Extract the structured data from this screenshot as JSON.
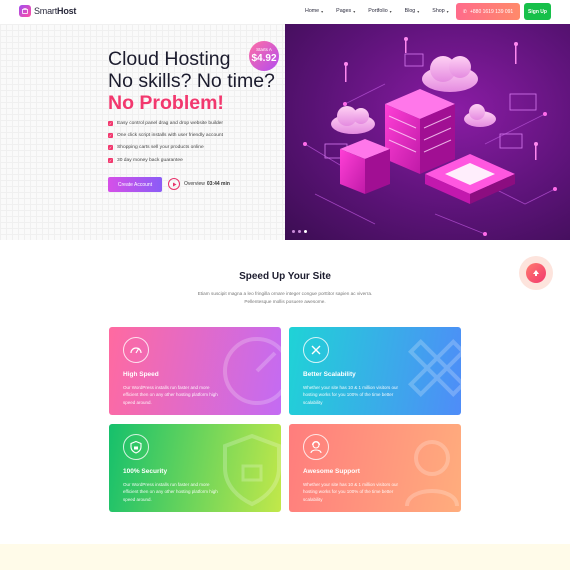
{
  "nav": {
    "brand_light": "Smart",
    "brand_bold": "Host",
    "menu": [
      {
        "label": "Home"
      },
      {
        "label": "Pages"
      },
      {
        "label": "Portfolio"
      },
      {
        "label": "Blog"
      },
      {
        "label": "Shop"
      }
    ],
    "phone": "+880 1619 139 091",
    "signup": "Sign Up"
  },
  "hero": {
    "title_line1": "Cloud Hosting",
    "title_line2": "No skills? No time?",
    "title_line3": "No Problem!",
    "badge_top": "Starts A",
    "badge_price": "$4.92",
    "features": [
      "Easy control panel drag and drop website builder",
      "One click script installs with user friendly account",
      "Shopping carts sell your products online",
      "30 day money back guarantee"
    ],
    "cta": "Create Account",
    "overview_label": "Overview",
    "overview_time": "03:44 min",
    "colors": {
      "accent": "#f2386e",
      "purple": "#8a1ca4"
    }
  },
  "section": {
    "title": "Speed Up Your Site",
    "desc": "Etiam suscipit magna a leo fringilla ornare integer congue porttitor sapien ac viverra. Pellentesque mollis posuere awesome."
  },
  "cards": [
    {
      "title": "High Speed",
      "text": "Our WordPress installs run faster and more efficient then on any other hosting platform high speed around.",
      "icon": "speedometer-icon"
    },
    {
      "title": "Better Scalability",
      "text": "Whether your site has 10 & 1 million visitors our hosting works for you 100% of the time better scalability",
      "icon": "pencil-ruler-icon"
    },
    {
      "title": "100% Security",
      "text": "Our WordPress installs run faster and more efficient then on any other hosting platform high speed around.",
      "icon": "shield-lock-icon"
    },
    {
      "title": "Awesome Support",
      "text": "Whether your site has 10 & 1 million visitors our hosting works for you 100% of the time better scalability",
      "icon": "support-agent-icon"
    }
  ]
}
